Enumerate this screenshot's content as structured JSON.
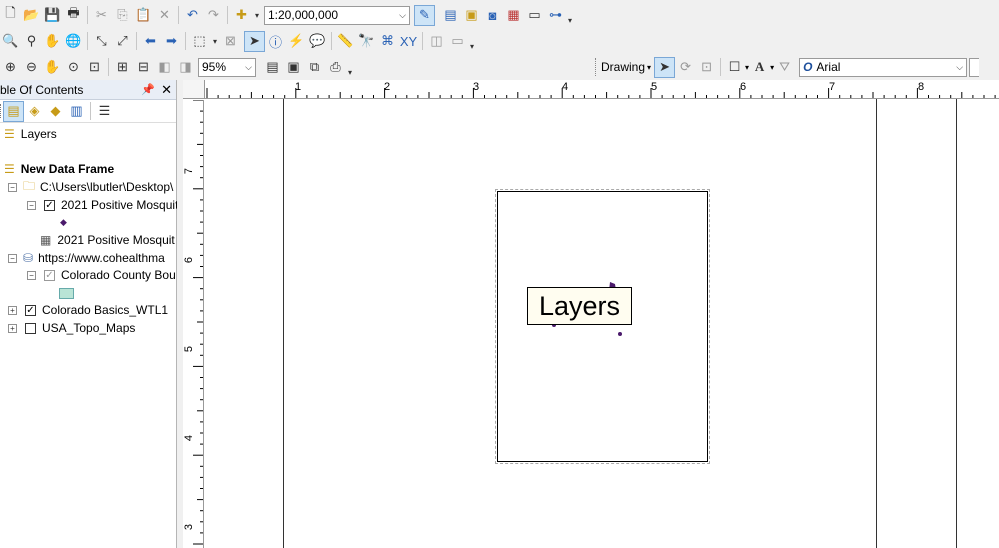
{
  "toolbar_standard": {
    "scale_value": "1:20,000,000"
  },
  "toolbar_layout": {
    "zoom_value": "95%"
  },
  "toolbar_drawing": {
    "drawing_menu_label": "Drawing",
    "font_value": "Arial"
  },
  "toc": {
    "title": "ble Of Contents",
    "layers_root": "Layers",
    "data_frame": "New Data Frame",
    "folder_path": "C:\\Users\\lbutler\\Desktop\\",
    "layer_1": "2021 Positive Mosquit",
    "table_1": "2021 Positive Mosquit",
    "service_url": "https://www.cohealthma",
    "county_layer": "Colorado County Bou",
    "basics_layer": "Colorado Basics_WTL1",
    "topo_layer": "USA_Topo_Maps"
  },
  "ruler": {
    "h_labels": [
      "1",
      "2",
      "3",
      "4",
      "5",
      "6",
      "7",
      "8"
    ],
    "v_labels": [
      "7",
      "6",
      "5",
      "4",
      "3"
    ]
  },
  "layout_view": {
    "frame_label": "Layers"
  },
  "colors": {
    "toc_header": "#e9eef6",
    "feature_point": "#4b1a6b",
    "county_swatch": "#b9e4d6",
    "selection_blue": "#cde4f7"
  }
}
